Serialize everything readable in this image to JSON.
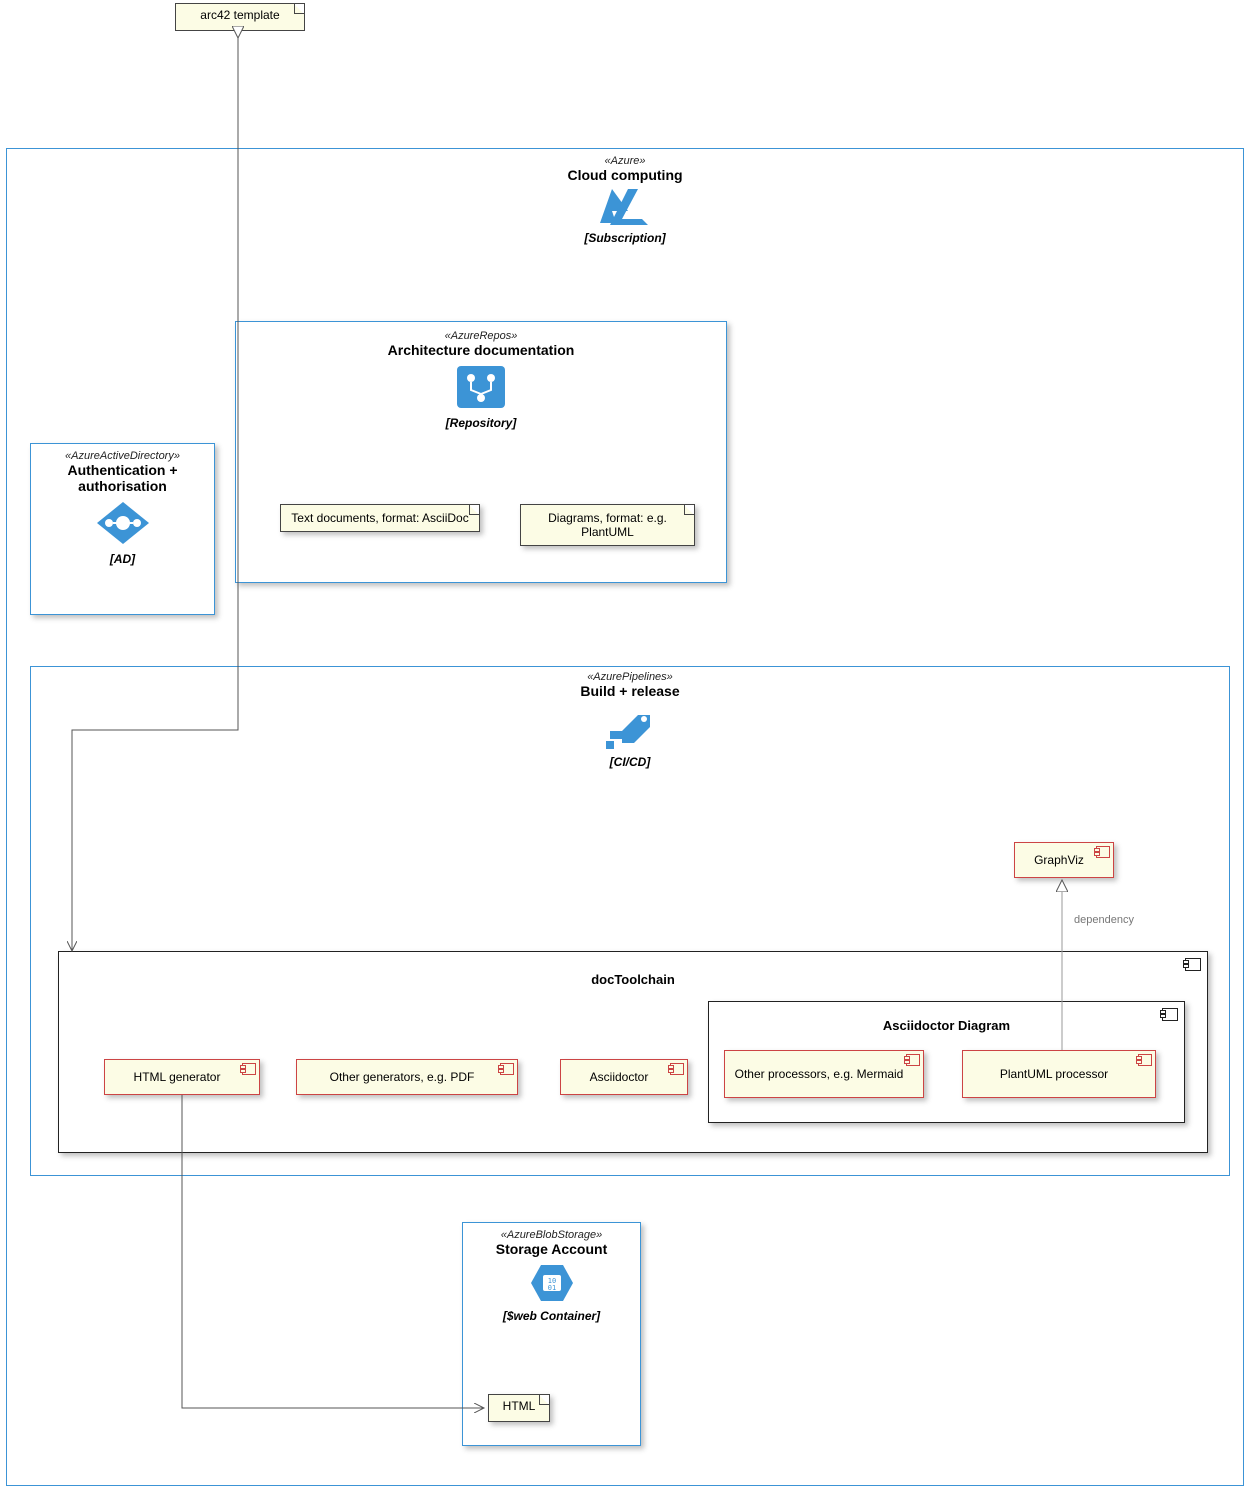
{
  "notes": {
    "arc42": "arc42 template",
    "textDocs": "Text documents, format: AsciiDoc",
    "diagrams": "Diagrams, format: e.g. PlantUML",
    "html": "HTML"
  },
  "azure": {
    "stereotype": "«Azure»",
    "title": "Cloud computing",
    "subtitle": "[Subscription]"
  },
  "repos": {
    "stereotype": "«AzureRepos»",
    "title": "Architecture documentation",
    "subtitle": "[Repository]"
  },
  "ad": {
    "stereotype": "«AzureActiveDirectory»",
    "title1": "Authentication +",
    "title2": "authorisation",
    "subtitle": "[AD]"
  },
  "pipelines": {
    "stereotype": "«AzurePipelines»",
    "title": "Build + release",
    "subtitle": "[CI/CD]"
  },
  "storage": {
    "stereotype": "«AzureBlobStorage»",
    "title": "Storage Account",
    "subtitle": "[$web Container]"
  },
  "packages": {
    "docToolchain": "docToolchain",
    "asciidoctorDiagram": "Asciidoctor Diagram"
  },
  "components": {
    "graphviz": "GraphViz",
    "htmlGen": "HTML generator",
    "otherGen": "Other generators, e.g. PDF",
    "asciidoctor": "Asciidoctor",
    "otherProc": "Other processors, e.g. Mermaid",
    "plantuml": "PlantUML processor"
  },
  "edgeLabels": {
    "dependency": "dependency"
  }
}
